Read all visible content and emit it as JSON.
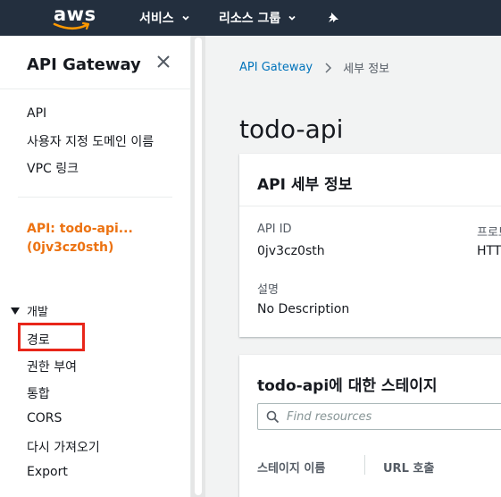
{
  "topnav": {
    "logo": "aws",
    "services_label": "서비스",
    "resource_groups_label": "리소스 그룹",
    "pin_icon": "pin-icon"
  },
  "sidebar": {
    "title": "API Gateway",
    "links": [
      "API",
      "사용자 지정 도메인 이름",
      "VPC 링크"
    ],
    "api_line1": "API: todo-api...",
    "api_line2": "(0jv3cz0sth)",
    "section": "개발",
    "dev_items": [
      "경로",
      "권한 부여",
      "통합",
      "CORS",
      "다시 가져오기",
      "Export"
    ]
  },
  "breadcrumb": {
    "root": "API Gateway",
    "current": "세부 정보"
  },
  "main": {
    "title": "todo-api",
    "details_card": {
      "header": "API 세부 정보",
      "api_id_label": "API ID",
      "api_id_value": "0jv3cz0sth",
      "protocol_label": "프로토",
      "protocol_value": "HTTP",
      "description_label": "설명",
      "description_value": "No Description"
    },
    "stages_card": {
      "header": "todo-api에 대한 스테이지",
      "search_placeholder": "Find resources",
      "columns": [
        "스테이지 이름",
        "URL 호출"
      ]
    }
  },
  "colors": {
    "nav_bg": "#232f3e",
    "accent_orange": "#ec7211",
    "link_blue": "#0073bb",
    "highlight_red": "#e8261a"
  }
}
